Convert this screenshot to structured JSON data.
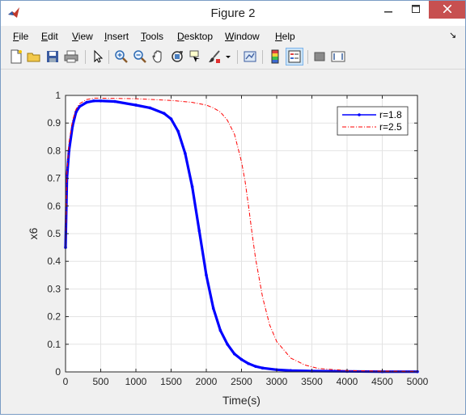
{
  "window": {
    "title": "Figure 2"
  },
  "menubar": {
    "items": [
      {
        "first": "F",
        "rest": "ile"
      },
      {
        "first": "E",
        "rest": "dit"
      },
      {
        "first": "V",
        "rest": "iew"
      },
      {
        "first": "I",
        "rest": "nsert"
      },
      {
        "first": "T",
        "rest": "ools"
      },
      {
        "first": "D",
        "rest": "esktop"
      },
      {
        "first": "W",
        "rest": "indow"
      },
      {
        "first": "H",
        "rest": "elp"
      }
    ]
  },
  "toolbar": {
    "icons": [
      "new-figure-icon",
      "open-file-icon",
      "save-icon",
      "print-icon",
      "pointer-icon",
      "zoom-in-icon",
      "zoom-out-icon",
      "pan-hand-icon",
      "rotate-3d-icon",
      "data-cursor-icon",
      "brush-icon",
      "brush-dropdown-icon",
      "link-plot-icon",
      "colorbar-icon",
      "legend-icon",
      "hide-plot-tools-icon",
      "show-plot-tools-icon"
    ]
  },
  "colors": {
    "series1": "#0000ff",
    "series2": "#ff0000",
    "close": "#c75050"
  },
  "chart_data": {
    "type": "line",
    "xlabel": "Time(s)",
    "ylabel": "x6",
    "xlim": [
      0,
      5000
    ],
    "ylim": [
      0,
      1
    ],
    "xticks": [
      0,
      500,
      1000,
      1500,
      2000,
      2500,
      3000,
      3500,
      4000,
      4500,
      5000
    ],
    "yticks": [
      0,
      0.1,
      0.2,
      0.3,
      0.4,
      0.5,
      0.6,
      0.7,
      0.8,
      0.9,
      1
    ],
    "grid": true,
    "legend_position": "top-right",
    "series": [
      {
        "name": "r=1.8",
        "style": "solid-thick-with-dots",
        "x": [
          0,
          20,
          50,
          100,
          150,
          200,
          300,
          400,
          500,
          700,
          1000,
          1200,
          1400,
          1500,
          1600,
          1700,
          1800,
          1900,
          2000,
          2100,
          2200,
          2300,
          2400,
          2500,
          2600,
          2700,
          2800,
          3000,
          3200,
          3500,
          4000,
          4500,
          5000
        ],
        "y": [
          0.45,
          0.7,
          0.8,
          0.89,
          0.94,
          0.96,
          0.975,
          0.98,
          0.98,
          0.978,
          0.965,
          0.955,
          0.935,
          0.915,
          0.87,
          0.79,
          0.67,
          0.51,
          0.35,
          0.23,
          0.15,
          0.1,
          0.065,
          0.045,
          0.03,
          0.02,
          0.014,
          0.008,
          0.005,
          0.003,
          0.002,
          0.001,
          0.001
        ]
      },
      {
        "name": "r=2.5",
        "style": "dash-dot-thin",
        "x": [
          0,
          20,
          50,
          100,
          150,
          200,
          300,
          400,
          500,
          1000,
          1500,
          1800,
          2000,
          2100,
          2200,
          2300,
          2400,
          2500,
          2550,
          2600,
          2650,
          2700,
          2800,
          2900,
          3000,
          3200,
          3400,
          3600,
          4000,
          4500,
          5000
        ],
        "y": [
          0.45,
          0.72,
          0.83,
          0.91,
          0.95,
          0.97,
          0.985,
          0.99,
          0.99,
          0.988,
          0.982,
          0.975,
          0.965,
          0.955,
          0.94,
          0.91,
          0.86,
          0.76,
          0.69,
          0.6,
          0.5,
          0.41,
          0.27,
          0.17,
          0.11,
          0.05,
          0.025,
          0.012,
          0.005,
          0.003,
          0.002
        ]
      }
    ]
  }
}
